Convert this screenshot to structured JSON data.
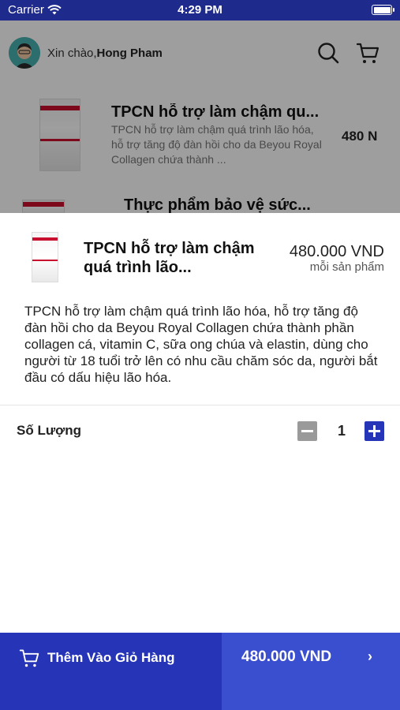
{
  "status_bar": {
    "carrier": "Carrier",
    "time": "4:29 PM"
  },
  "header": {
    "greeting": "Xin chào,",
    "user_name": "Hong Pham",
    "icons": [
      "search-icon",
      "cart-icon"
    ]
  },
  "background_list": [
    {
      "title": "TPCN hỗ trợ làm chậm qu...",
      "description": "TPCN hỗ trợ làm chậm quá trình lão hóa, hỗ trợ tăng độ đàn hồi cho da Beyou Royal Collagen chứa thành ...",
      "price": "480 N"
    },
    {
      "title": "Thực phẩm bảo vệ sức..."
    }
  ],
  "product_sheet": {
    "name": "TPCN hỗ trợ làm chậm quá trình lão...",
    "price": "480.000 VND",
    "unit": "mỗi sản phẩm",
    "description": "TPCN hỗ trợ làm chậm quá trình lão hóa, hỗ trợ tăng độ đàn hồi cho da Beyou Royal Collagen chứa thành phần collagen cá, vitamin C, sữa ong chúa và elastin, dùng cho người từ 18 tuổi trở lên có nhu cầu chăm sóc da, người bắt đầu có dấu hiệu lão hóa.",
    "quantity_label": "Số Lượng",
    "quantity": "1"
  },
  "bottom_bar": {
    "add_to_cart_label": "Thêm Vào Giỏ Hàng",
    "total": "480.000 VND",
    "chevron": "›"
  },
  "colors": {
    "status_bar": "#1e2a8c",
    "primary": "#2634b8",
    "total_bg": "#3a4ed0",
    "minus_button": "#9a9a9a"
  }
}
